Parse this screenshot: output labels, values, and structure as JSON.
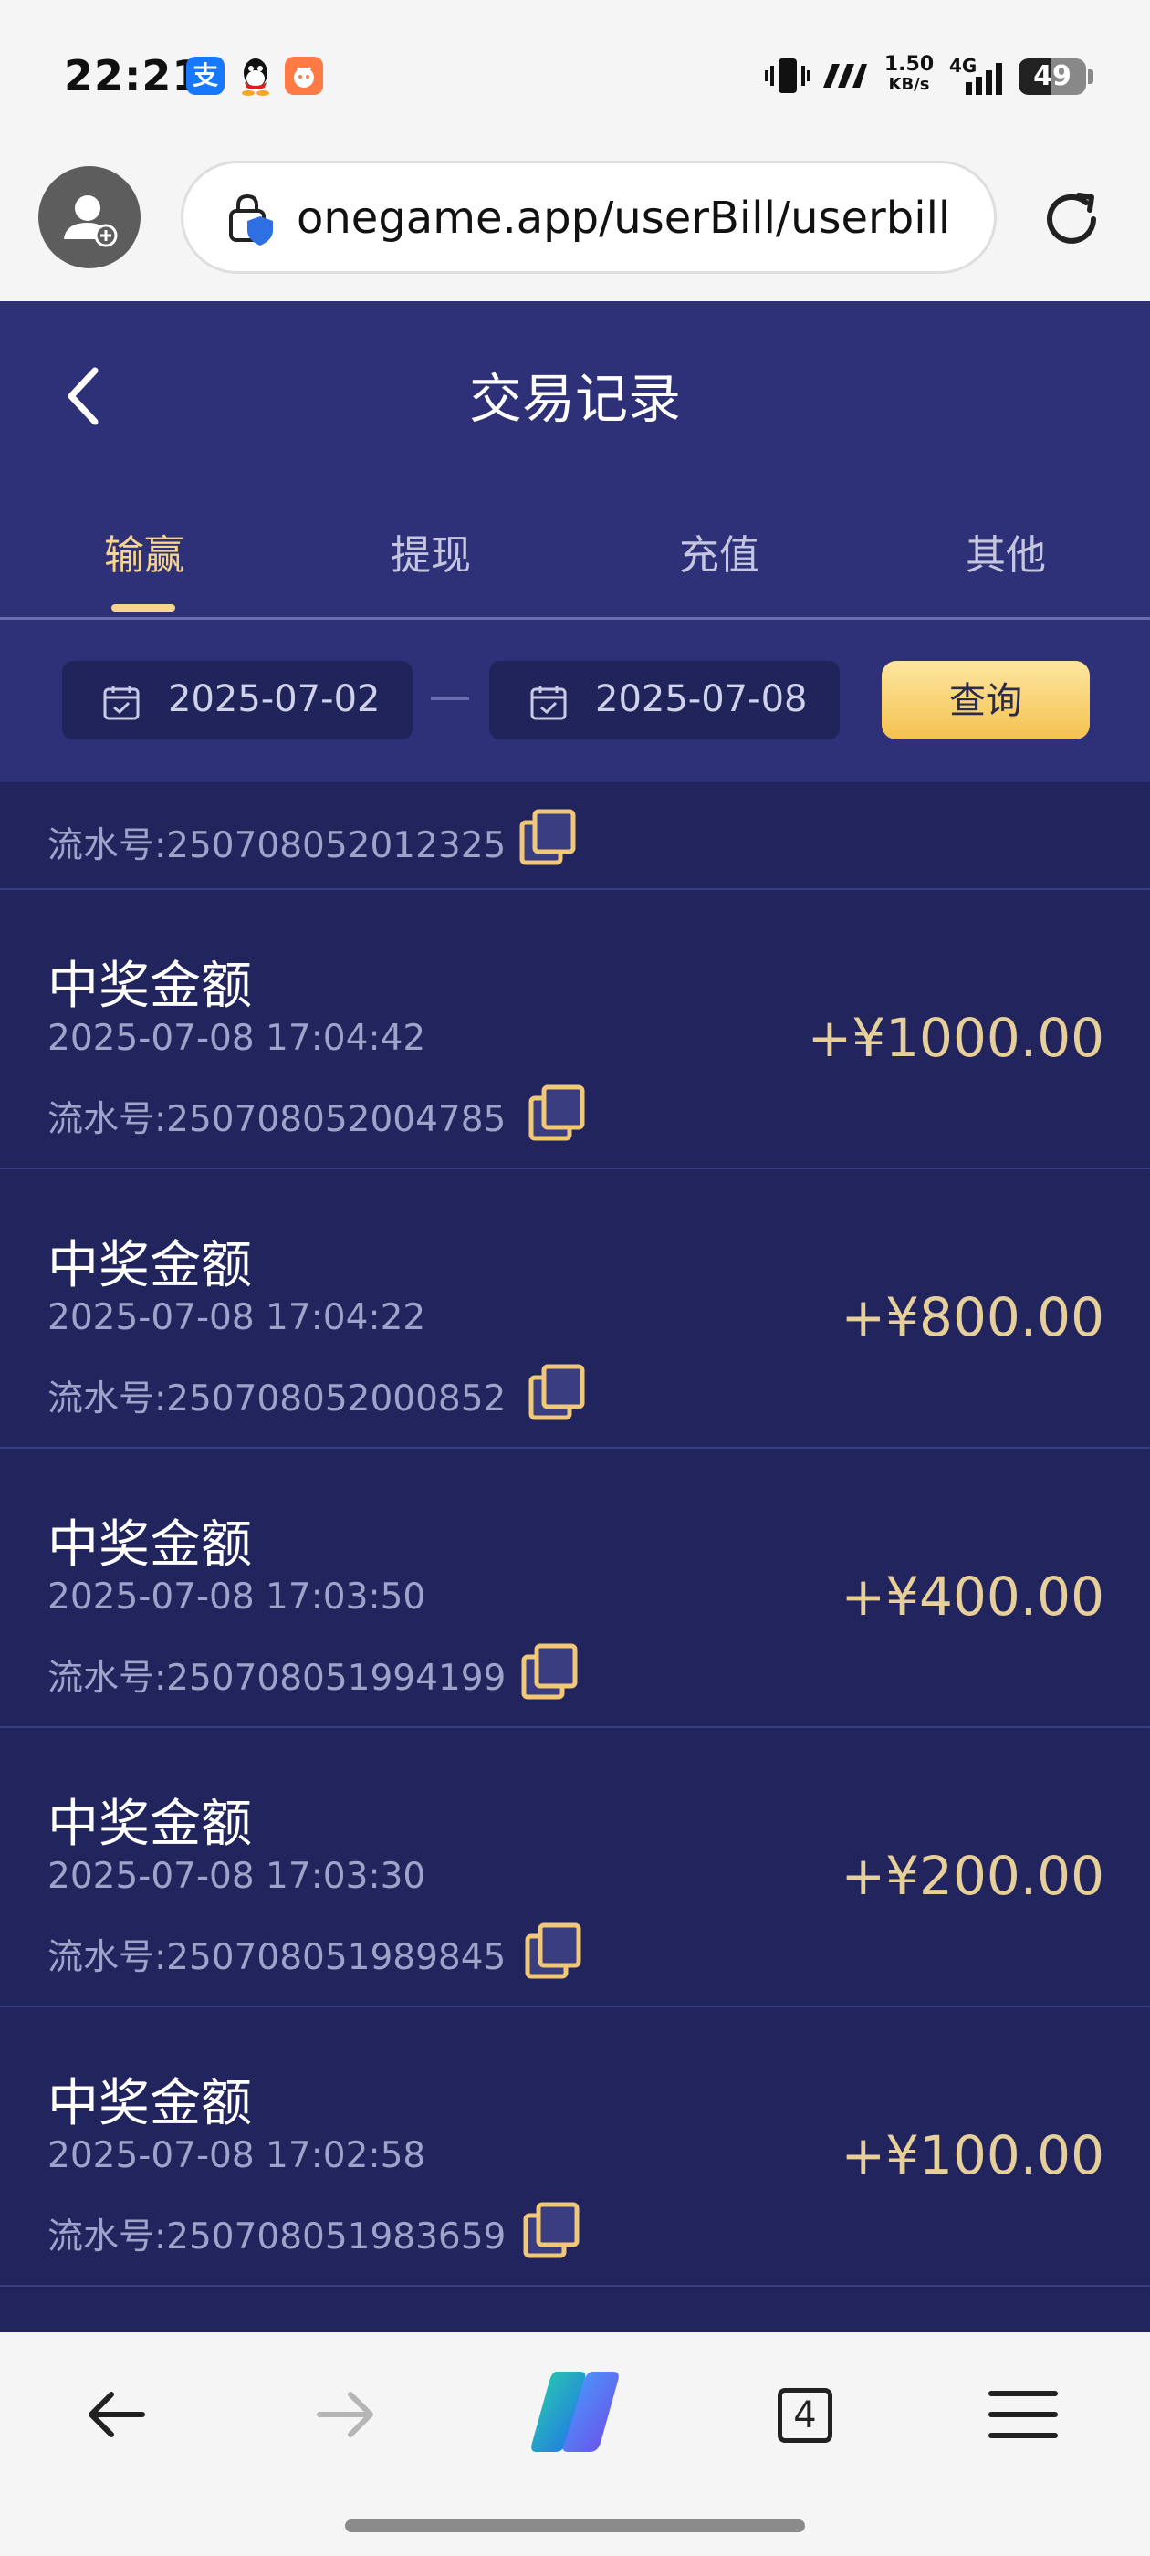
{
  "status_bar": {
    "time": "22:21",
    "speed_value": "1.50",
    "speed_unit": "KB/s",
    "network": "4G",
    "battery": "49",
    "battery_level": 0.49
  },
  "browser": {
    "url": "onegame.app/userBill/userbill"
  },
  "header": {
    "title": "交易记录",
    "tabs": [
      {
        "label": "输赢",
        "active": true
      },
      {
        "label": "提现",
        "active": false
      },
      {
        "label": "充值",
        "active": false
      },
      {
        "label": "其他",
        "active": false
      }
    ]
  },
  "filter": {
    "start_date": "2025-07-02",
    "end_date": "2025-07-08",
    "query_label": "查询"
  },
  "partial_record": {
    "serial": "流水号:250708052012325"
  },
  "records": [
    {
      "title": "中奖金额",
      "time": "2025-07-08 17:04:42",
      "serial": "流水号:250708052004785",
      "amount": "+¥1000.00"
    },
    {
      "title": "中奖金额",
      "time": "2025-07-08 17:04:22",
      "serial": "流水号:250708052000852",
      "amount": "+¥800.00"
    },
    {
      "title": "中奖金额",
      "time": "2025-07-08 17:03:50",
      "serial": "流水号:250708051994199",
      "amount": "+¥400.00"
    },
    {
      "title": "中奖金额",
      "time": "2025-07-08 17:03:30",
      "serial": "流水号:250708051989845",
      "amount": "+¥200.00"
    },
    {
      "title": "中奖金额",
      "time": "2025-07-08 17:02:58",
      "serial": "流水号:250708051983659",
      "amount": "+¥100.00"
    }
  ],
  "bottom_nav": {
    "tab_count": "4"
  },
  "colors": {
    "header_bg": "#2e3078",
    "list_bg": "#22245e",
    "accent_gold": "#f7d58b",
    "amount": "#e7cf9a"
  }
}
